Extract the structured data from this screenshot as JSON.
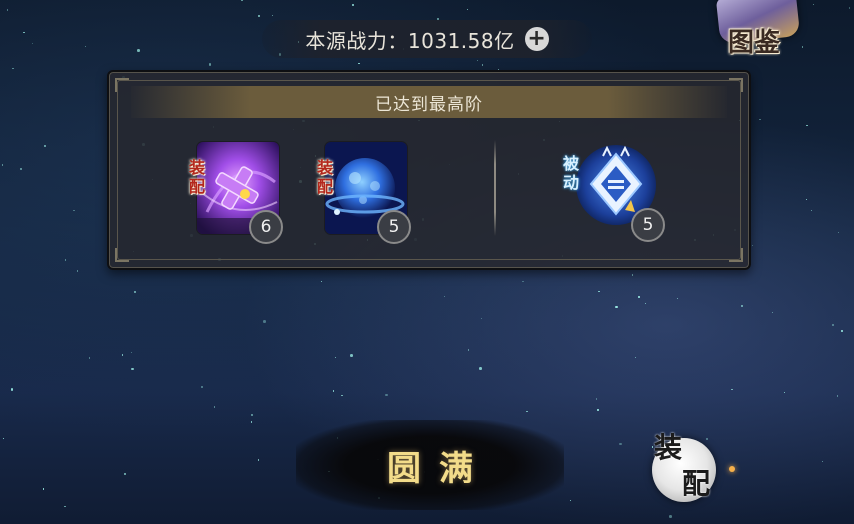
{
  "power": {
    "text": "本源战力：1031.58亿",
    "plus_label": "+"
  },
  "codex": {
    "label": "图鉴"
  },
  "panel": {
    "header": "已达到最高阶",
    "skills": [
      {
        "tag": "装配",
        "tag_type": "equip",
        "level": "6",
        "icon": "purple-orb-skill-icon",
        "colors": [
          "#3b1a7a",
          "#a14ee8"
        ]
      },
      {
        "tag": "装配",
        "tag_type": "equip",
        "level": "5",
        "icon": "blue-planet-skill-icon",
        "colors": [
          "#0e1f6b",
          "#3a8cf0"
        ]
      },
      {
        "tag": "被动",
        "tag_type": "passive",
        "level": "5",
        "icon": "blue-emblem-passive-icon",
        "colors": [
          "#1a3a8a",
          "#6fa8f2"
        ]
      }
    ]
  },
  "complete_button": {
    "label": "圆满"
  },
  "equip_button": {
    "char1": "装",
    "char2": "配"
  }
}
